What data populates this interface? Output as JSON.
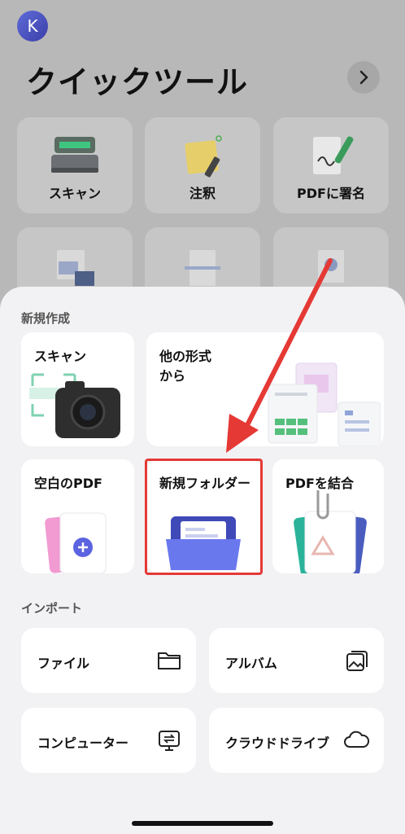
{
  "header": {
    "avatar_initial": "K",
    "title": "クイックツール"
  },
  "quick_tools": {
    "items": [
      {
        "label": "スキャン"
      },
      {
        "label": "注釈"
      },
      {
        "label": "PDFに署名"
      }
    ]
  },
  "new_section": {
    "title": "新規作成",
    "items": [
      {
        "label": "スキャン"
      },
      {
        "label": "他の形式\nから"
      },
      {
        "label": "空白のPDF"
      },
      {
        "label": "新規フォルダー"
      },
      {
        "label": "PDFを結合"
      }
    ]
  },
  "import_section": {
    "title": "インポート",
    "items": [
      {
        "label": "ファイル",
        "icon": "folder-icon"
      },
      {
        "label": "アルバム",
        "icon": "album-icon"
      },
      {
        "label": "コンピューター",
        "icon": "computer-transfer-icon"
      },
      {
        "label": "クラウドドライブ",
        "icon": "cloud-icon"
      }
    ]
  },
  "colors": {
    "accent": "#5b63e0",
    "highlight": "#e53935"
  }
}
